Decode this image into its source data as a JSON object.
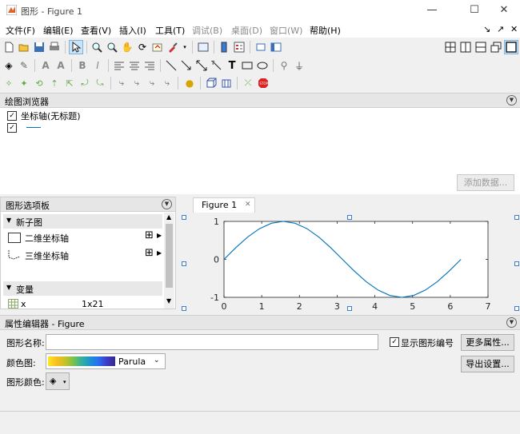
{
  "window": {
    "title": "图形 - Figure 1",
    "controls": {
      "minimize": "—",
      "maximize": "☐",
      "close": "✕"
    }
  },
  "menu": [
    {
      "label": "文件(F)",
      "disabled": false
    },
    {
      "label": "编辑(E)",
      "disabled": false
    },
    {
      "label": "查看(V)",
      "disabled": false
    },
    {
      "label": "插入(I)",
      "disabled": false
    },
    {
      "label": "工具(T)",
      "disabled": false
    },
    {
      "label": "调试(B)",
      "disabled": true
    },
    {
      "label": "桌面(D)",
      "disabled": true
    },
    {
      "label": "窗口(W)",
      "disabled": true
    },
    {
      "label": "帮助(H)",
      "disabled": false
    }
  ],
  "plot_browser": {
    "title": "绘图浏览器",
    "items": [
      {
        "label": "坐标轴(无标题)",
        "checked": true
      },
      {
        "label": "",
        "checked": true
      }
    ],
    "add_data_button": "添加数据..."
  },
  "palette": {
    "title": "图形选项板",
    "sections": [
      {
        "label": "新子图",
        "items": [
          {
            "label": "二维坐标轴"
          },
          {
            "label": "三维坐标轴"
          }
        ]
      },
      {
        "label": "变量",
        "items": [
          {
            "name": "x",
            "size": "1x21"
          }
        ]
      }
    ]
  },
  "tab": {
    "label": "Figure 1",
    "close": "✕"
  },
  "chart_data": {
    "type": "line",
    "x": [
      0,
      0.3142,
      0.6283,
      0.9425,
      1.2566,
      1.5708,
      1.885,
      2.1991,
      2.5133,
      2.8274,
      3.1416,
      3.4558,
      3.7699,
      4.0841,
      4.3982,
      4.7124,
      5.0265,
      5.3407,
      5.6549,
      5.969,
      6.2832
    ],
    "series": [
      {
        "values": [
          0,
          0.309,
          0.5878,
          0.809,
          0.9511,
          1,
          0.9511,
          0.809,
          0.5878,
          0.309,
          0,
          -0.309,
          -0.5878,
          -0.809,
          -0.9511,
          -1,
          -0.9511,
          -0.809,
          -0.5878,
          -0.309,
          0
        ]
      }
    ],
    "xlim": [
      0,
      7
    ],
    "ylim": [
      -1,
      1
    ],
    "xticks": [
      "0",
      "1",
      "2",
      "3",
      "4",
      "5",
      "6",
      "7"
    ],
    "yticks": [
      "1",
      "0",
      "-1"
    ],
    "color": "#0072bd",
    "grid": false
  },
  "property_editor": {
    "title": "属性编辑器 - Figure",
    "name_label": "图形名称:",
    "name_value": "",
    "show_number_label": "显示图形编号",
    "show_number_checked": true,
    "colormap_label": "颜色图:",
    "colormap_value": "Parula",
    "color_label": "图形颜色:",
    "more_button": "更多属性...",
    "export_button": "导出设置..."
  }
}
